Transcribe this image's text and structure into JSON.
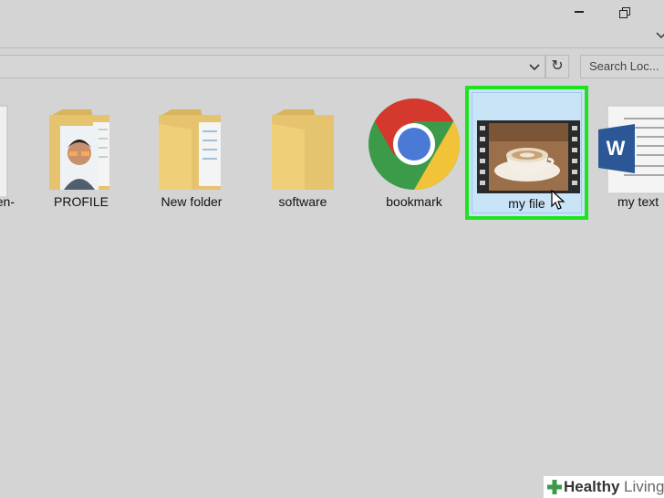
{
  "search": {
    "placeholder": "Search Loc..."
  },
  "address_bar": {
    "refresh_symbol": "↻"
  },
  "items": [
    {
      "label": "en-"
    },
    {
      "label": "PROFILE"
    },
    {
      "label": "New folder"
    },
    {
      "label": "software"
    },
    {
      "label": "bookmark"
    },
    {
      "label": "my file",
      "selected": true
    },
    {
      "label": "my text"
    }
  ],
  "icons": {
    "window": [
      "minimize-icon",
      "restore-icon",
      "chevron-down-icon"
    ],
    "files": [
      "folder-icon",
      "chrome-icon",
      "video-file-icon",
      "word-document-icon"
    ]
  },
  "colors": {
    "background": "#d4d4d4",
    "selection_fill": "#c9e3f7",
    "highlight_border": "#1ee31e",
    "folder": "#e6c46f",
    "word_blue": "#2b5797"
  },
  "watermark": {
    "part1": "Healthy",
    "part2": "Living"
  }
}
